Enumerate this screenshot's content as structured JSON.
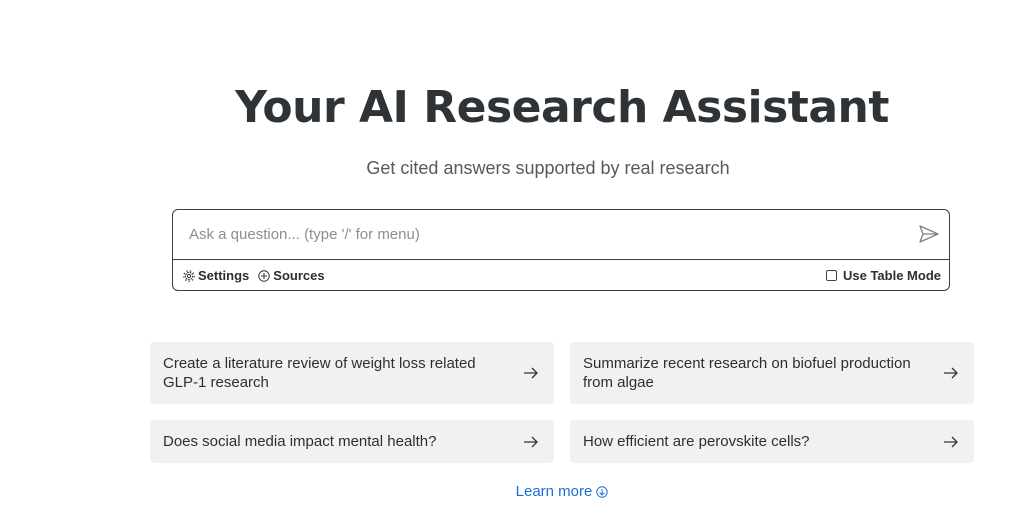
{
  "hero": {
    "title": "Your AI Research Assistant",
    "subtitle": "Get cited answers supported by real research"
  },
  "search": {
    "placeholder": "Ask a question... (type '/' for menu)",
    "value": "",
    "settings_label": "Settings",
    "sources_label": "Sources",
    "table_mode_label": "Use Table Mode",
    "table_mode_checked": false
  },
  "suggestions": [
    {
      "text": "Create a literature review of weight loss related GLP-1 research"
    },
    {
      "text": "Summarize recent research on biofuel production from algae"
    },
    {
      "text": "Does social media impact mental health?"
    },
    {
      "text": "How efficient are perovskite cells?"
    }
  ],
  "learn_more": {
    "label": "Learn more"
  },
  "colors": {
    "accent_link": "#1a6fd6",
    "card_bg": "#f1f1f1",
    "title_text": "#2e3338"
  },
  "icons": {
    "send": "send-arrow-icon",
    "settings": "gear-icon",
    "sources": "plus-circle-icon",
    "suggestion_arrow": "arrow-right-icon",
    "learn_more": "arrow-down-circle-icon"
  }
}
